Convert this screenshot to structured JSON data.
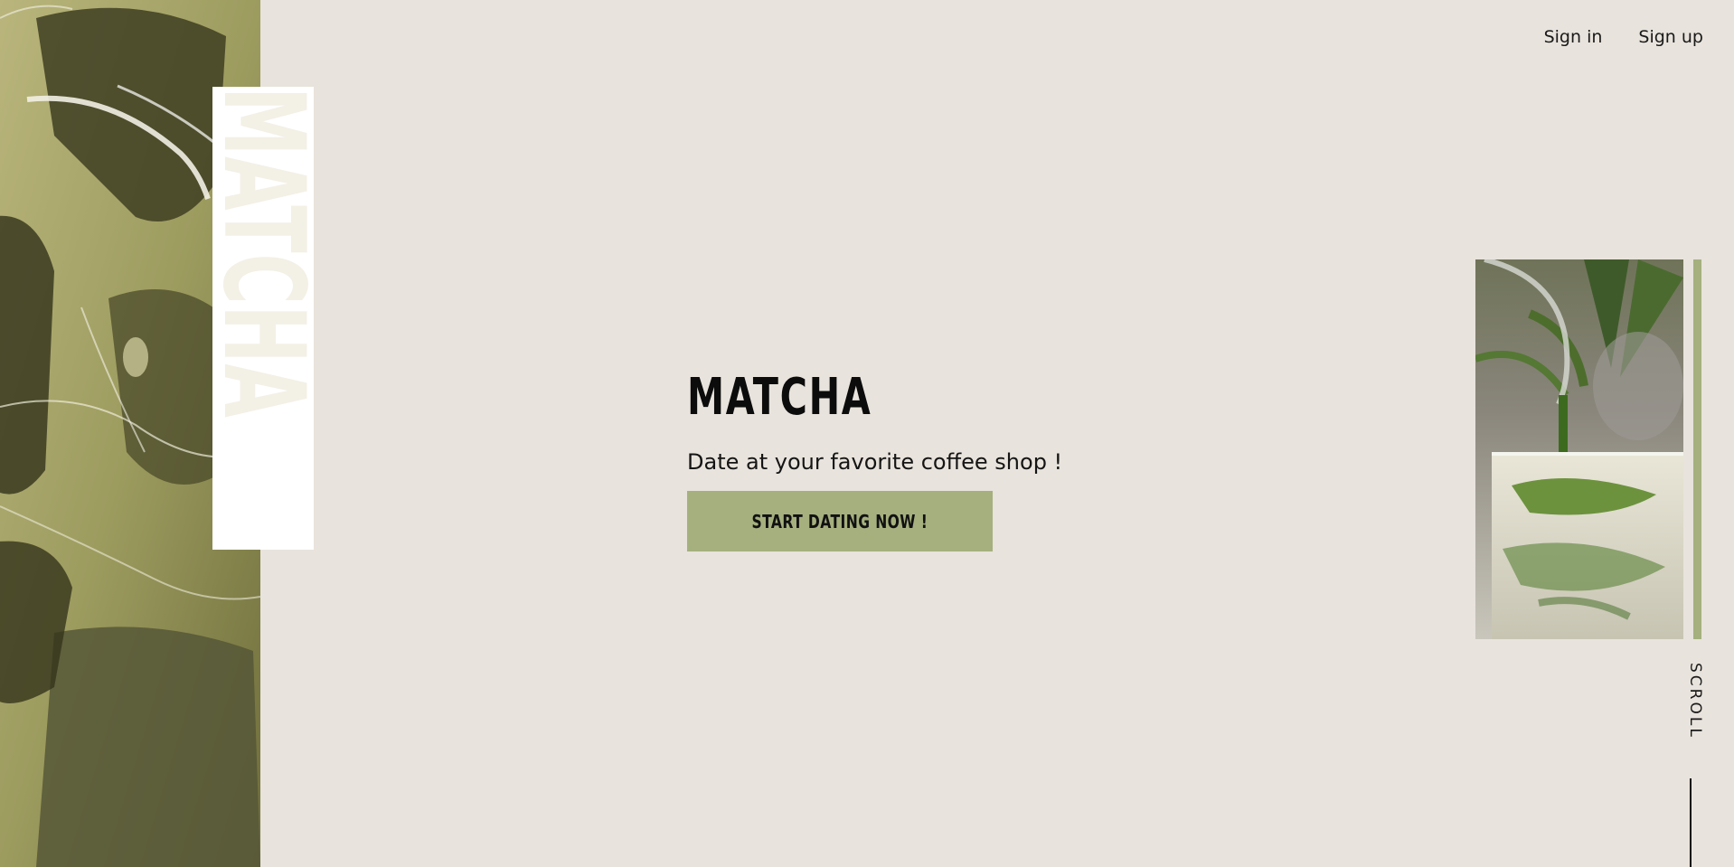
{
  "nav": {
    "sign_in": "Sign in",
    "sign_up": "Sign up"
  },
  "brand": {
    "vertical_word": "MATCHA"
  },
  "hero": {
    "title": "MATCHA",
    "subtitle": "Date at your favorite coffee shop !",
    "cta_label": "START DATING NOW !"
  },
  "scroll": {
    "label": "SCROLL"
  },
  "colors": {
    "background": "#e8e3dc",
    "accent": "#a5b07e",
    "text": "#0c0c0c"
  }
}
